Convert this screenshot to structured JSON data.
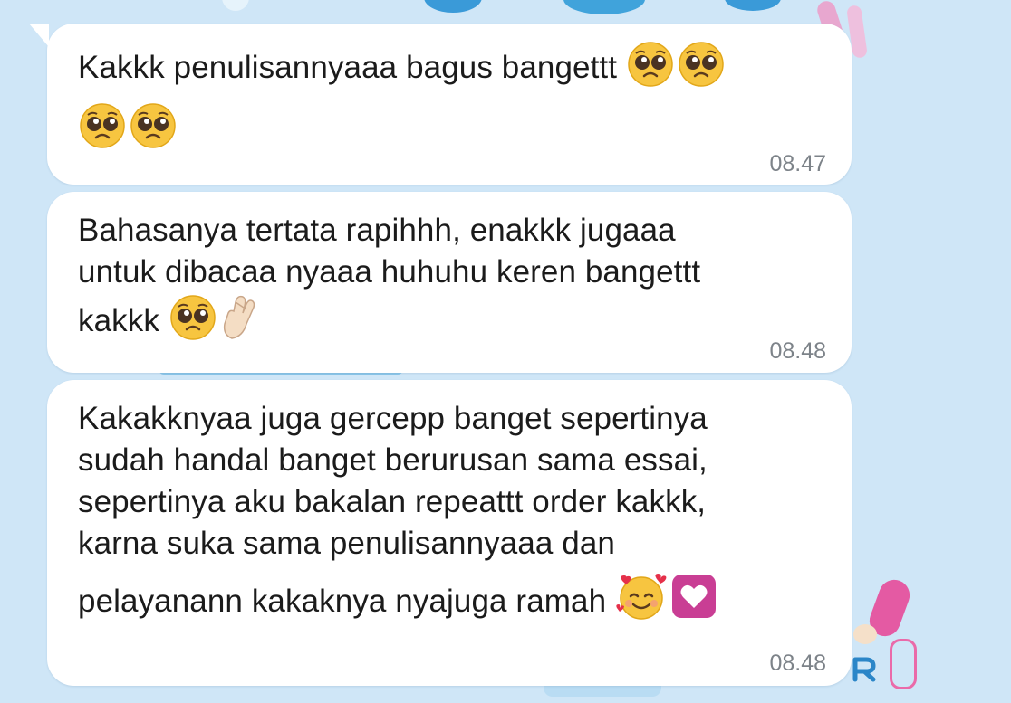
{
  "theme": {
    "background": "#cfe6f7",
    "bubble": "#ffffff",
    "text": "#1b1b1b",
    "time": "#7d8389"
  },
  "messages": [
    {
      "segments": [
        "Kakkk penulisannyaaa bagus bangettt"
      ],
      "time": "08.47",
      "emoji": [
        "pleading-face-icon",
        "pleading-face-icon",
        "pleading-face-icon",
        "pleading-face-icon"
      ]
    },
    {
      "segments": [
        "Bahasanya tertata rapihhh, enakkk jugaaa",
        "untuk dibacaa nyaaa huhuhu keren bangettt",
        "kakkk"
      ],
      "time": "08.48",
      "emoji": [
        "pleading-face-icon",
        "crossed-fingers-icon"
      ]
    },
    {
      "segments": [
        "Kakakknyaa juga gercepp banget sepertinya",
        "sudah handal banget berurusan sama essai,",
        "sepertinya aku bakalan repeattt order kakkk,",
        "karna suka sama penulisannyaaa dan",
        "pelayanann kakaknya nyajuga ramah"
      ],
      "time": "08.48",
      "emoji": [
        "smiling-face-with-hearts-icon",
        "heart-box-icon"
      ]
    }
  ]
}
